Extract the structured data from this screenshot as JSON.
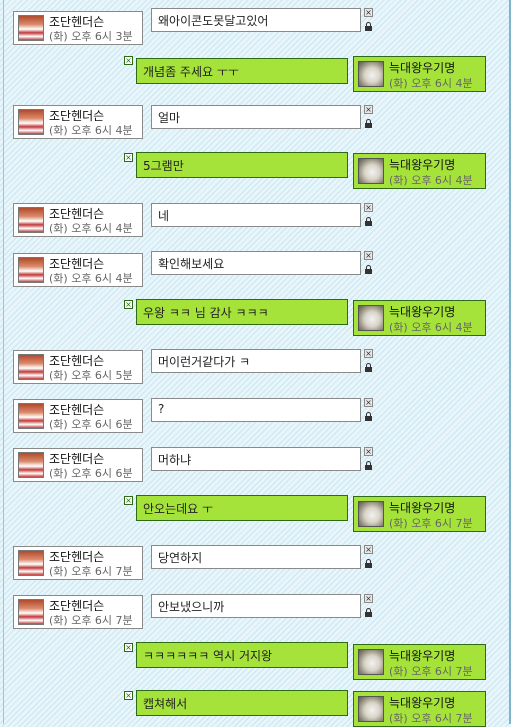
{
  "other_user": {
    "name": "조단헨더슨"
  },
  "me": {
    "name": "늑대왕우기명"
  },
  "close_glyph": "×",
  "messages": [
    {
      "from": "other",
      "time": "(화) 오후 6시 3분",
      "text": "왜아이콘도못달고있어"
    },
    {
      "from": "me",
      "time": "(화) 오후 6시 4분",
      "text": "개념좀 주세요 ㅜㅜ"
    },
    {
      "from": "other",
      "time": "(화) 오후 6시 4분",
      "text": "얼마"
    },
    {
      "from": "me",
      "time": "(화) 오후 6시 4분",
      "text": "5그램만"
    },
    {
      "from": "other",
      "time": "(화) 오후 6시 4분",
      "text": "네"
    },
    {
      "from": "other",
      "time": "(화) 오후 6시 4분",
      "text": "확인해보세요"
    },
    {
      "from": "me",
      "time": "(화) 오후 6시 4분",
      "text": "우왕 ㅋㅋ 님 감사 ㅋㅋㅋ"
    },
    {
      "from": "other",
      "time": "(화) 오후 6시 5분",
      "text": "머이런거같다가 ㅋ"
    },
    {
      "from": "other",
      "time": "(화) 오후 6시 6분",
      "text": "?"
    },
    {
      "from": "other",
      "time": "(화) 오후 6시 6분",
      "text": "머하냐"
    },
    {
      "from": "me",
      "time": "(화) 오후 6시 7분",
      "text": "안오는데요 ㅜ"
    },
    {
      "from": "other",
      "time": "(화) 오후 6시 7분",
      "text": "당연하지"
    },
    {
      "from": "other",
      "time": "(화) 오후 6시 7분",
      "text": "안보냈으니까"
    },
    {
      "from": "me",
      "time": "(화) 오후 6시 7분",
      "text": "ㅋㅋㅋㅋㅋㅋ 역시 거지왕"
    },
    {
      "from": "me",
      "time": "(화) 오후 6시 7분",
      "text": "캡쳐해서"
    }
  ]
}
